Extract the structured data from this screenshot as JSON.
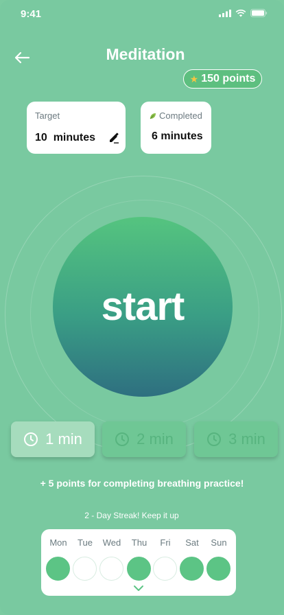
{
  "status_bar": {
    "time": "9:41"
  },
  "header": {
    "title": "Meditation",
    "points_label": "150 points"
  },
  "cards": {
    "target": {
      "label": "Target",
      "value": "10  minutes"
    },
    "completed": {
      "label": "Completed",
      "value": "6 minutes"
    }
  },
  "start": {
    "label": "start"
  },
  "durations": [
    {
      "label": "1 min",
      "selected": true
    },
    {
      "label": "2 min",
      "selected": false
    },
    {
      "label": "3 min",
      "selected": false
    }
  ],
  "bonus_text": "+ 5 points for completing breathing practice!",
  "streak_text": "2 - Day Streak! Keep it up",
  "week": [
    {
      "day": "Mon",
      "done": true
    },
    {
      "day": "Tue",
      "done": false
    },
    {
      "day": "Wed",
      "done": false
    },
    {
      "day": "Thu",
      "done": true
    },
    {
      "day": "Fri",
      "done": false
    },
    {
      "day": "Sat",
      "done": true
    },
    {
      "day": "Sun",
      "done": true
    }
  ],
  "colors": {
    "background": "#79c9a0",
    "accent_green": "#5cc485",
    "start_gradient_top": "#55c47f",
    "start_gradient_bottom": "#2e6f80"
  }
}
